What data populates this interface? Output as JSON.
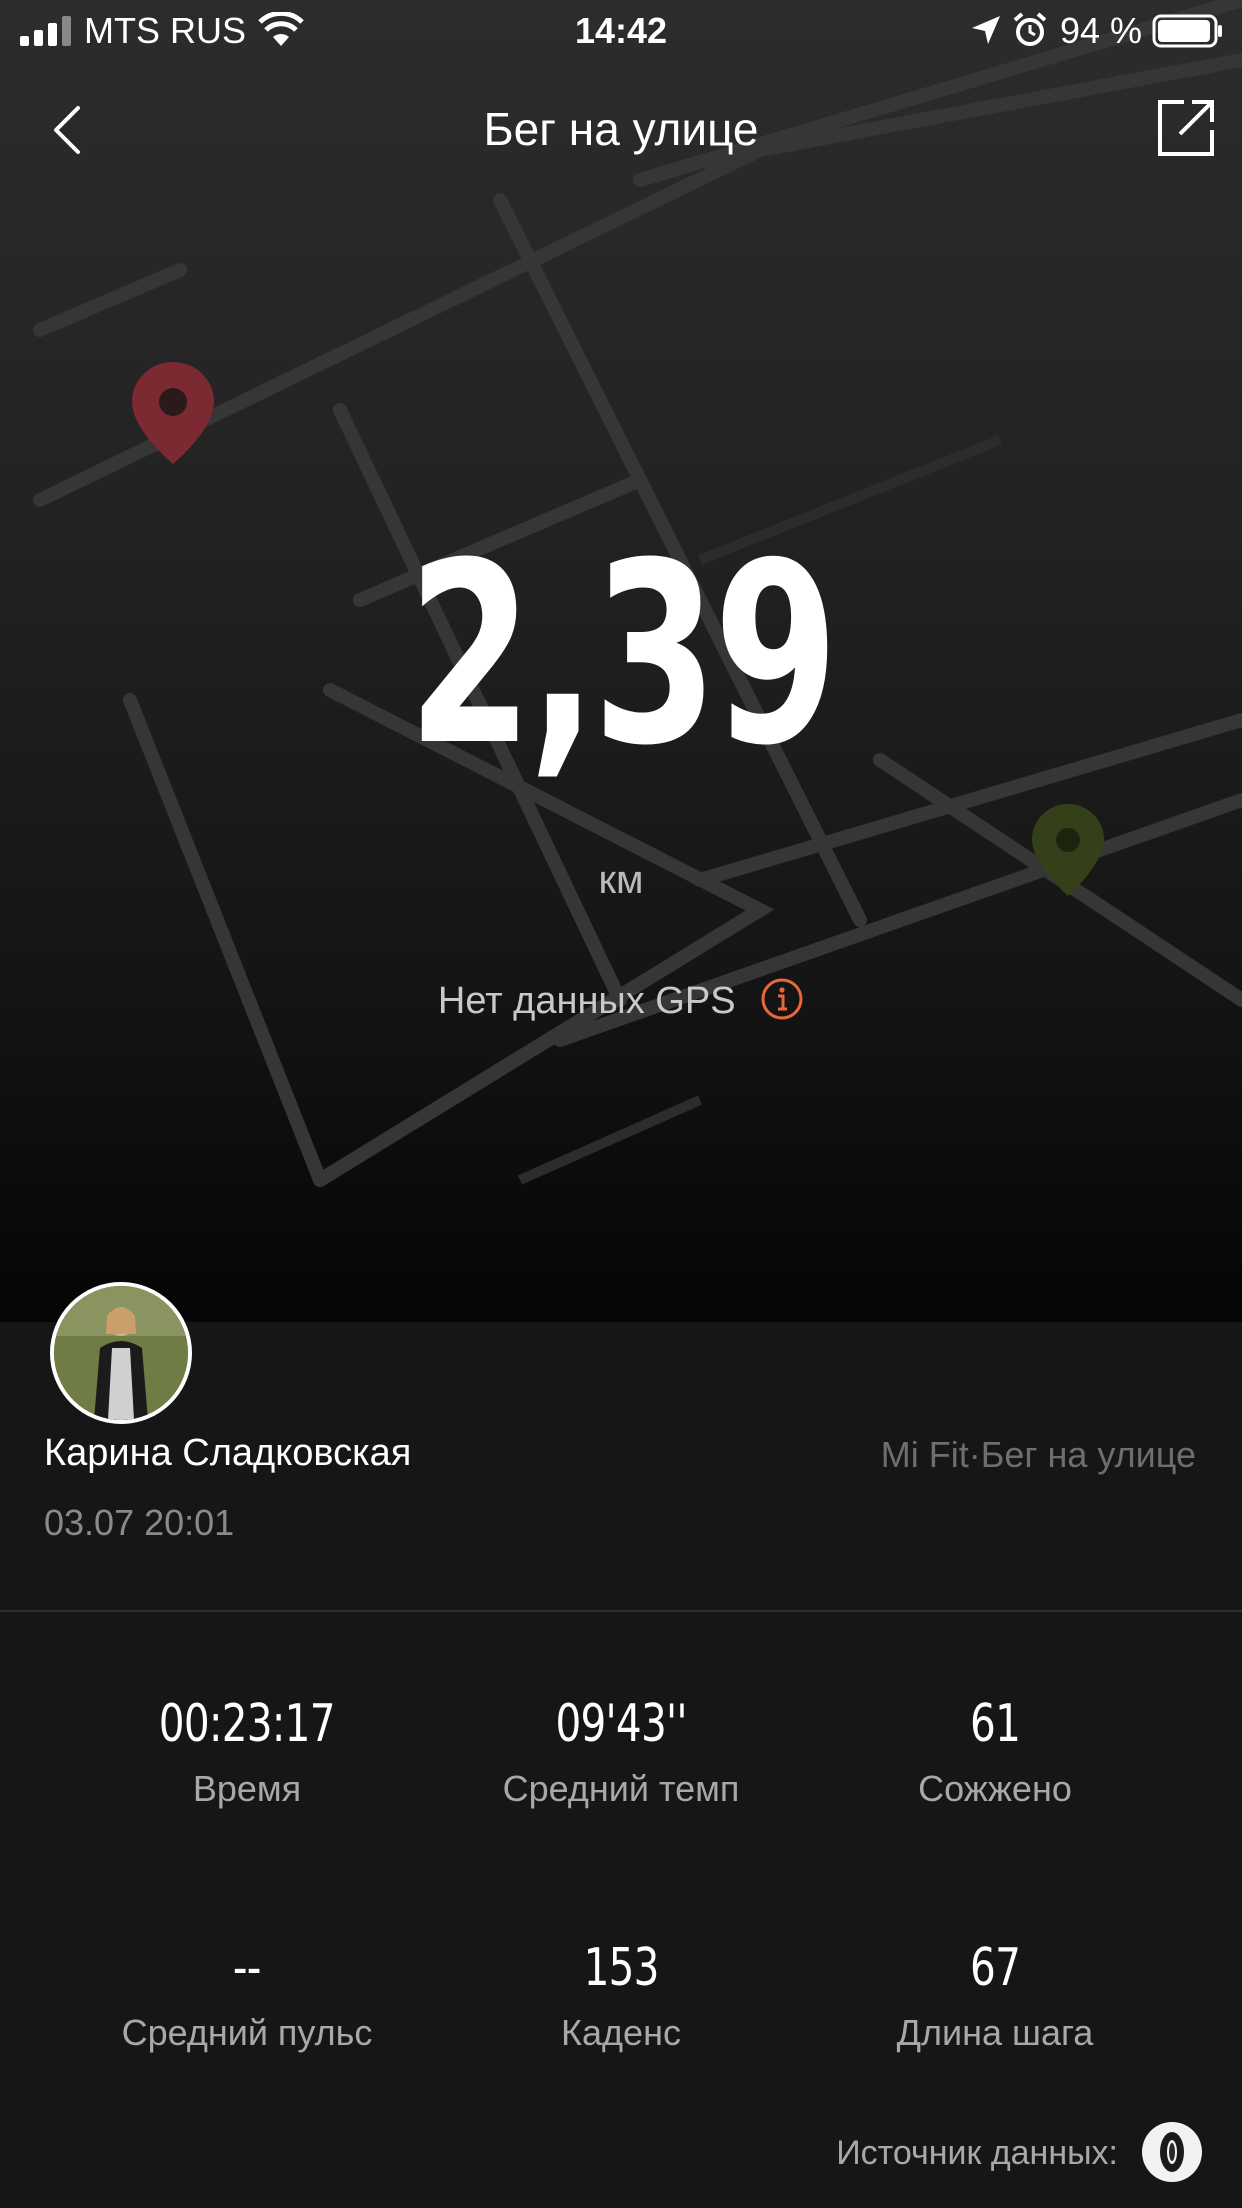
{
  "status_bar": {
    "carrier": "MTS RUS",
    "time": "14:42",
    "battery_percent": "94 %",
    "icons": [
      "signal-icon",
      "wifi-icon",
      "location-arrow-icon",
      "alarm-icon",
      "battery-icon"
    ]
  },
  "header": {
    "title": "Бег на улице",
    "back_icon": "chevron-left-icon",
    "share_icon": "share-icon"
  },
  "summary": {
    "distance": "2,39",
    "unit": "км",
    "gps_note": "Нет данных GPS",
    "gps_info_icon": "info-icon"
  },
  "profile": {
    "name": "Карина Сладковская",
    "date": "03.07 20:01",
    "source": "Mi Fit·Бег на улице"
  },
  "stats": [
    {
      "value": "00:23:17",
      "label": "Время"
    },
    {
      "value": "09'43''",
      "label": "Средний темп"
    },
    {
      "value": "61",
      "label": "Сожжено"
    },
    {
      "value": "--",
      "label": "Средний пульс"
    },
    {
      "value": "153",
      "label": "Каденс"
    },
    {
      "value": "67",
      "label": "Длина шага"
    }
  ],
  "data_source": {
    "label": "Источник данных:",
    "device_icon": "fitness-band-icon"
  },
  "colors": {
    "accent": "#e8673a",
    "start_marker": "#8b2a2f",
    "end_marker": "#3d4a1c"
  }
}
